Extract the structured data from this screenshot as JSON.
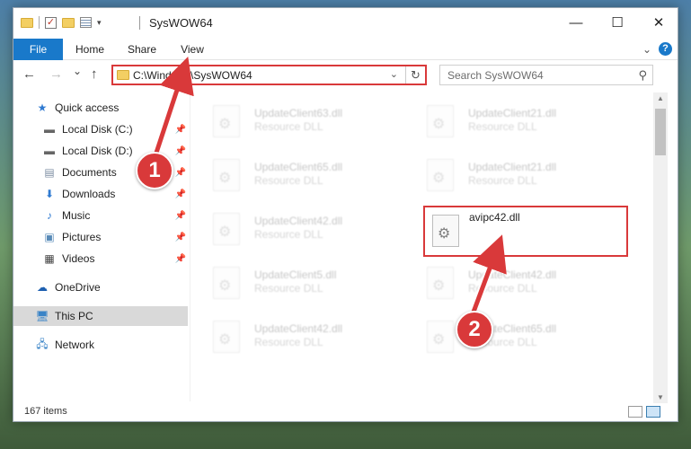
{
  "window": {
    "title": "SysWOW64",
    "controls": {
      "minimize": "—",
      "maximize": "☐",
      "close": "✕"
    }
  },
  "ribbon": {
    "tabs": [
      "File",
      "Home",
      "Share",
      "View"
    ],
    "expand_icon": "chevron-down-icon",
    "help_icon": "?"
  },
  "nav": {
    "back": "←",
    "forward": "→",
    "recent": "⌄",
    "up": "↑",
    "address": "C:\\Windows\\SysWOW64",
    "search_placeholder": "Search SysWOW64"
  },
  "sidebar": {
    "items": [
      {
        "label": "Quick access",
        "icon": "star-icon",
        "pinned": false
      },
      {
        "label": "Local Disk (C:)",
        "icon": "drive-icon",
        "pinned": true
      },
      {
        "label": "Local Disk (D:)",
        "icon": "drive-icon",
        "pinned": true
      },
      {
        "label": "Documents",
        "icon": "documents-icon",
        "pinned": true
      },
      {
        "label": "Downloads",
        "icon": "download-icon",
        "pinned": true
      },
      {
        "label": "Music",
        "icon": "music-icon",
        "pinned": true
      },
      {
        "label": "Pictures",
        "icon": "pictures-icon",
        "pinned": true
      },
      {
        "label": "Videos",
        "icon": "videos-icon",
        "pinned": true
      },
      {
        "label": "OneDrive",
        "icon": "cloud-icon",
        "pinned": false
      },
      {
        "label": "This PC",
        "icon": "computer-icon",
        "pinned": false,
        "selected": true
      },
      {
        "label": "Network",
        "icon": "network-icon",
        "pinned": false
      }
    ]
  },
  "files": [
    {
      "name": "UpdateClient63.dll",
      "type": "Resource DLL"
    },
    {
      "name": "UpdateClient21.dll",
      "type": "Resource DLL"
    },
    {
      "name": "UpdateClient65.dll",
      "type": "Resource DLL"
    },
    {
      "name": "UpdateClient21.dll",
      "type": "Resource DLL"
    },
    {
      "name": "UpdateClient42.dll",
      "type": "Resource DLL"
    },
    {
      "name": "avipc42.dll",
      "type": ""
    },
    {
      "name": "UpdateClient5.dll",
      "type": "Resource DLL"
    },
    {
      "name": "UpdateClient42.dll",
      "type": "Resource DLL"
    },
    {
      "name": "UpdateClient42.dll",
      "type": "Resource DLL"
    },
    {
      "name": "UpdateClient65.dll",
      "type": "Resource DLL"
    }
  ],
  "status": {
    "item_count": "167 items"
  },
  "annotations": {
    "step1": "1",
    "step2": "2",
    "color": "#d9393a"
  }
}
